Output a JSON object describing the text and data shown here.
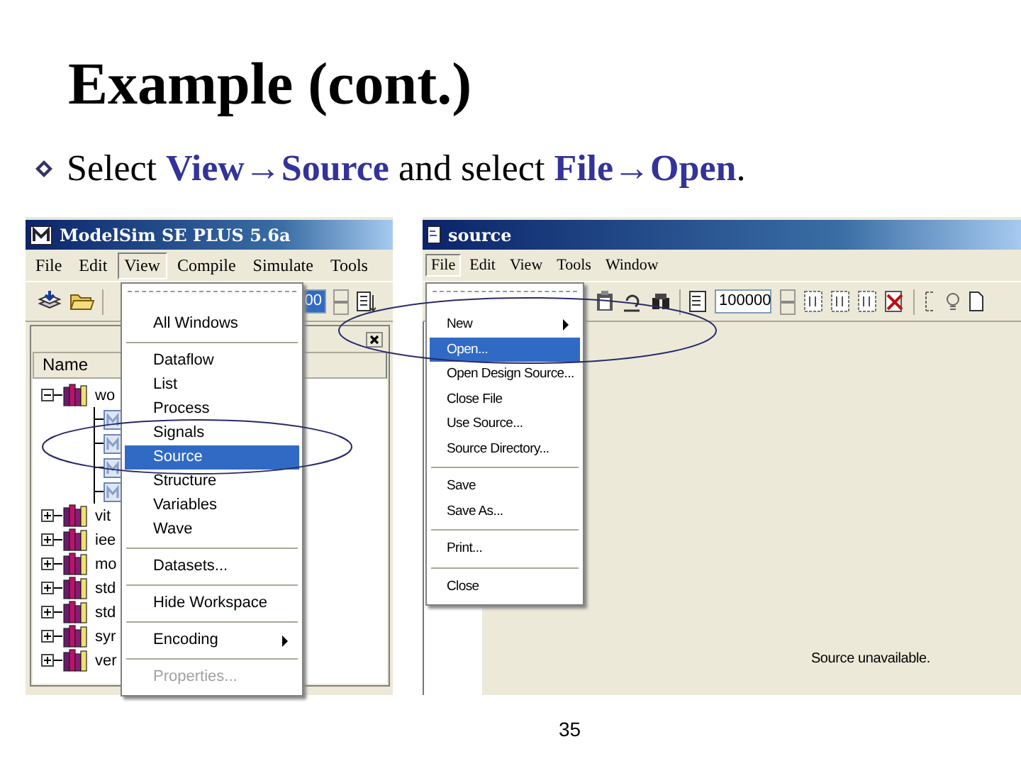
{
  "slide": {
    "title": "Example (cont.)",
    "bullet": "Select **View→Source** and select **File→Open**.",
    "page_number": "35"
  },
  "left_window": {
    "title": "ModelSim SE PLUS 5.6a",
    "menu": [
      {
        "label": "File",
        "selected": false
      },
      {
        "label": "Edit",
        "selected": false
      },
      {
        "label": "View",
        "selected": true
      },
      {
        "label": "Compile",
        "selected": false
      },
      {
        "label": "Simulate",
        "selected": false
      },
      {
        "label": "Tools",
        "selected": false
      }
    ],
    "toolbar_field": "00",
    "workspace": {
      "column": "Name",
      "tree": [
        {
          "label": "wo",
          "kind": "library",
          "expanded": true,
          "children": [
            {
              "kind": "module"
            },
            {
              "kind": "module"
            },
            {
              "kind": "module"
            },
            {
              "kind": "module"
            }
          ]
        },
        {
          "label": "vit",
          "kind": "library",
          "expanded": false
        },
        {
          "label": "iee",
          "kind": "library",
          "expanded": false
        },
        {
          "label": "mo",
          "kind": "library",
          "expanded": false
        },
        {
          "label": "std",
          "kind": "library",
          "expanded": false
        },
        {
          "label": "std",
          "kind": "library",
          "expanded": false
        },
        {
          "label": "syr",
          "kind": "library",
          "expanded": false
        },
        {
          "label": "ver",
          "kind": "library",
          "expanded": false
        }
      ]
    },
    "view_menu": {
      "groups": [
        [
          {
            "label": "All Windows",
            "selected": false,
            "disabled": false,
            "submenu": false
          }
        ],
        [
          {
            "label": "Dataflow",
            "selected": false,
            "disabled": false,
            "submenu": false
          },
          {
            "label": "List",
            "selected": false,
            "disabled": false,
            "submenu": false
          },
          {
            "label": "Process",
            "selected": false,
            "disabled": false,
            "submenu": false
          },
          {
            "label": "Signals",
            "selected": false,
            "disabled": false,
            "submenu": false
          },
          {
            "label": "Source",
            "selected": true,
            "disabled": false,
            "submenu": false
          },
          {
            "label": "Structure",
            "selected": false,
            "disabled": false,
            "submenu": false
          },
          {
            "label": "Variables",
            "selected": false,
            "disabled": false,
            "submenu": false
          },
          {
            "label": "Wave",
            "selected": false,
            "disabled": false,
            "submenu": false
          }
        ],
        [
          {
            "label": "Datasets...",
            "selected": false,
            "disabled": false,
            "submenu": false
          }
        ],
        [
          {
            "label": "Hide Workspace",
            "selected": false,
            "disabled": false,
            "submenu": false
          }
        ],
        [
          {
            "label": "Encoding",
            "selected": false,
            "disabled": false,
            "submenu": true
          }
        ],
        [
          {
            "label": "Properties...",
            "selected": false,
            "disabled": true,
            "submenu": false
          }
        ]
      ]
    }
  },
  "right_window": {
    "title": "source",
    "menu": [
      {
        "label": "File",
        "selected": true
      },
      {
        "label": "Edit",
        "selected": false
      },
      {
        "label": "View",
        "selected": false
      },
      {
        "label": "Tools",
        "selected": false
      },
      {
        "label": "Window",
        "selected": false
      }
    ],
    "toolbar_field": "100000",
    "message": "Source unavailable.",
    "file_menu": {
      "groups": [
        [
          {
            "label": "New",
            "selected": false,
            "disabled": false,
            "submenu": true
          },
          {
            "label": "Open...",
            "selected": true,
            "disabled": false,
            "submenu": false
          },
          {
            "label": "Open Design Source...",
            "selected": false,
            "disabled": false,
            "submenu": false
          },
          {
            "label": "Close File",
            "selected": false,
            "disabled": false,
            "submenu": false
          },
          {
            "label": "Use Source...",
            "selected": false,
            "disabled": false,
            "submenu": false
          },
          {
            "label": "Source Directory...",
            "selected": false,
            "disabled": false,
            "submenu": false
          }
        ],
        [
          {
            "label": "Save",
            "selected": false,
            "disabled": false,
            "submenu": false
          },
          {
            "label": "Save As...",
            "selected": false,
            "disabled": false,
            "submenu": false
          }
        ],
        [
          {
            "label": "Print...",
            "selected": false,
            "disabled": false,
            "submenu": false
          }
        ],
        [
          {
            "label": "Close",
            "selected": false,
            "disabled": false,
            "submenu": false
          }
        ]
      ]
    }
  }
}
